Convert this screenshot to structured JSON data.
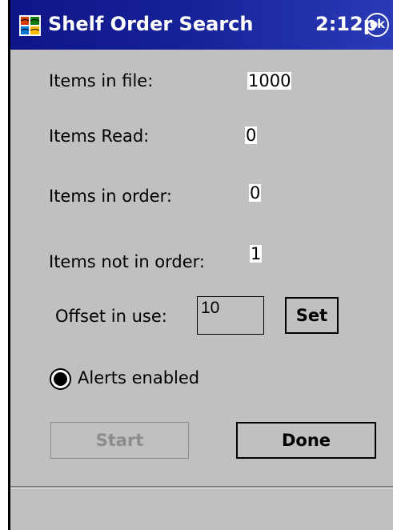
{
  "window": {
    "title": "Shelf Order Search",
    "clock": "2:12p",
    "ok_label": "ok",
    "logo_icon": "windows-flag-icon"
  },
  "stats": {
    "items_in_file_label": "Items in file:",
    "items_in_file_value": "1000",
    "items_read_label": "Items Read:",
    "items_read_value": "0",
    "items_in_order_label": "Items in order:",
    "items_in_order_value": "0",
    "items_not_in_order_label": "Items not in order:",
    "items_not_in_order_value": "1"
  },
  "offset": {
    "label": "Offset in use:",
    "value": "10",
    "set_label": "Set"
  },
  "alerts": {
    "label": "Alerts enabled",
    "checked": true
  },
  "actions": {
    "start_label": "Start",
    "start_enabled": false,
    "done_label": "Done"
  },
  "colors": {
    "titlebar": "#162196",
    "background": "#c0c0c0",
    "disabled_text": "#8c8c8c"
  }
}
